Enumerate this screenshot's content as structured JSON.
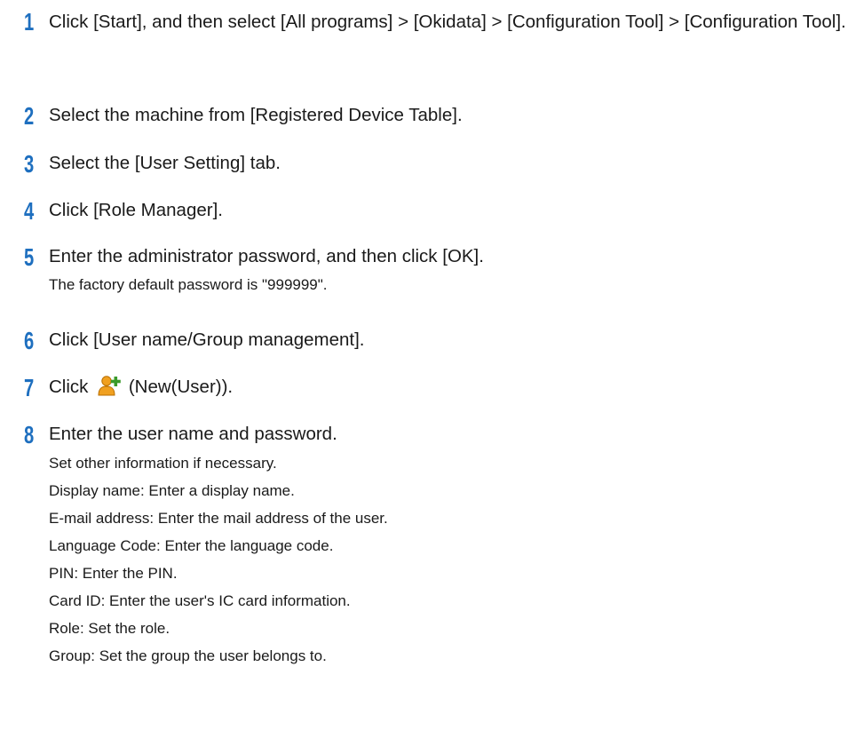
{
  "steps": [
    {
      "number": "1",
      "text": "Click [Start], and then select [All programs] > [Okidata] > [Configuration Tool] > [Configuration Tool]."
    },
    {
      "number": "2",
      "text": "Select the machine from [Registered Device Table]."
    },
    {
      "number": "3",
      "text": "Select the [User Setting] tab."
    },
    {
      "number": "4",
      "text": "Click [Role Manager]."
    },
    {
      "number": "5",
      "text": "Enter the administrator password, and then click [OK].",
      "note": "The factory default password is \"999999\"."
    },
    {
      "number": "6",
      "text": "Click [User name/Group management]."
    },
    {
      "number": "7",
      "text_before": "Click",
      "icon": "new-user-icon",
      "text_after": "(New(User))."
    },
    {
      "number": "8",
      "text": "Enter the user name and password.",
      "details": [
        "Set other information if necessary.",
        "Display name: Enter a display name.",
        "E-mail address: Enter the mail address of the user.",
        "Language Code: Enter the language code.",
        "PIN: Enter the PIN.",
        "Card ID: Enter the user's IC card information.",
        "Role: Set the role.",
        "Group: Set the group the user belongs to."
      ]
    }
  ],
  "colors": {
    "step_number": "#1e6fbf",
    "text": "#1a1a1a",
    "icon_person": "#f0a020",
    "icon_plus": "#3a9a2a"
  }
}
